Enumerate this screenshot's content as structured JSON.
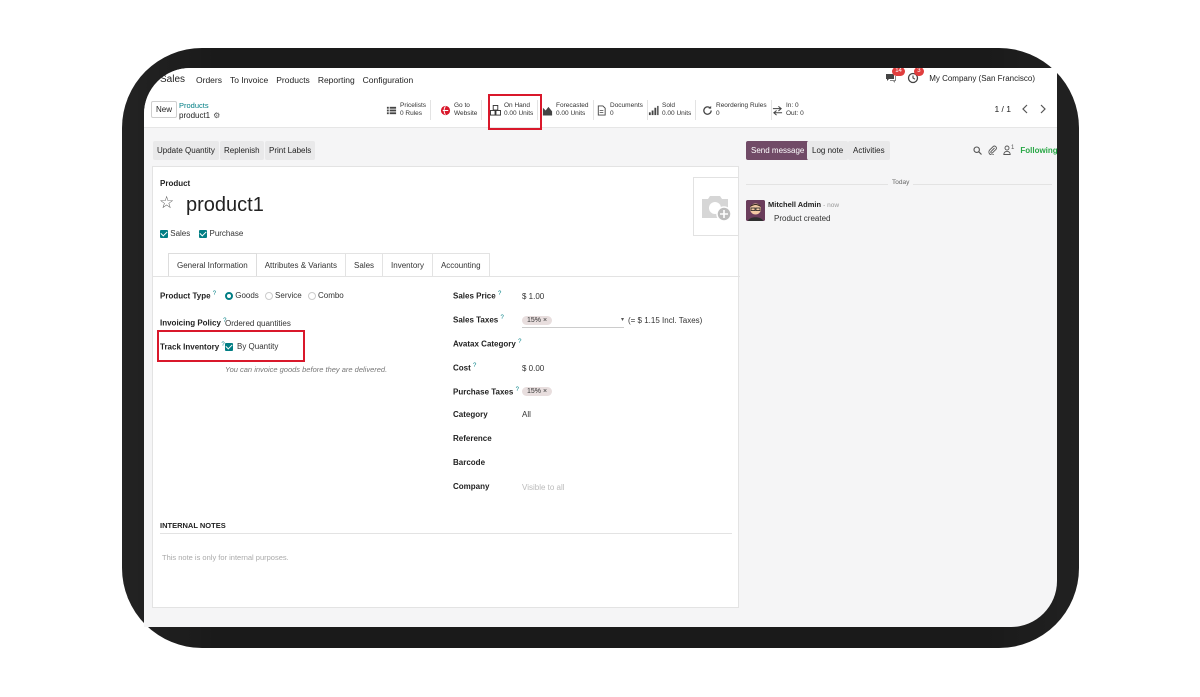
{
  "navbar": {
    "app": "Sales",
    "menu": [
      "Orders",
      "To Invoice",
      "Products",
      "Reporting",
      "Configuration"
    ],
    "messages_count": "14",
    "activities_count": "3",
    "company": "My Company (San Francisco)"
  },
  "control_panel": {
    "new_label": "New",
    "breadcrumb_parent": "Products",
    "breadcrumb_current": "product1",
    "smart_buttons": [
      {
        "line1": "Pricelists",
        "line2": "0 Rules"
      },
      {
        "line1": "Go to",
        "line2": "Website"
      },
      {
        "line1": "On Hand",
        "line2": "0.00 Units"
      },
      {
        "line1": "Forecasted",
        "line2": "0.00 Units"
      },
      {
        "line1": "Documents",
        "line2": "0"
      },
      {
        "line1": "Sold",
        "line2": "0.00 Units"
      },
      {
        "line1": "Reordering Rules",
        "line2": "0"
      },
      {
        "line1": "In: 0",
        "line2": "Out: 0"
      }
    ],
    "pager": "1 / 1"
  },
  "actions": {
    "update_quantity": "Update Quantity",
    "replenish": "Replenish",
    "print_labels": "Print Labels"
  },
  "form": {
    "record_type": "Product",
    "name": "product1",
    "flags": {
      "sales": "Sales",
      "purchase": "Purchase"
    },
    "tabs": [
      "General Information",
      "Attributes & Variants",
      "Sales",
      "Inventory",
      "Accounting"
    ],
    "left": {
      "product_type_label": "Product Type",
      "product_type_options": [
        "Goods",
        "Service",
        "Combo"
      ],
      "invoicing_policy_label": "Invoicing Policy",
      "invoicing_policy_value": "Ordered quantities",
      "track_inventory_label": "Track Inventory",
      "track_inventory_value": "By Quantity",
      "invoice_hint": "You can invoice goods before they are delivered."
    },
    "right": {
      "sales_price_label": "Sales Price",
      "sales_price_value": "$ 1.00",
      "sales_taxes_label": "Sales Taxes",
      "sales_taxes_tag": "15%",
      "sales_taxes_incl": "(= $ 1.15 Incl. Taxes)",
      "avatax_label": "Avatax Category",
      "cost_label": "Cost",
      "cost_value": "$ 0.00",
      "purchase_taxes_label": "Purchase Taxes",
      "purchase_taxes_tag": "15%",
      "category_label": "Category",
      "category_value": "All",
      "reference_label": "Reference",
      "barcode_label": "Barcode",
      "company_label": "Company",
      "company_placeholder": "Visible to all"
    },
    "internal_notes_title": "INTERNAL NOTES",
    "internal_notes_placeholder": "This note is only for internal purposes."
  },
  "chatter": {
    "send_message": "Send message",
    "log_note": "Log note",
    "activities": "Activities",
    "followers_count": "1",
    "following": "Following",
    "today": "Today",
    "author": "Mitchell Admin",
    "time": "- now",
    "message": "Product created"
  },
  "colors": {
    "accent": "#017e84",
    "primary_button": "#714b67",
    "highlight_box": "#d9182b",
    "badge": "#e03e3e"
  }
}
